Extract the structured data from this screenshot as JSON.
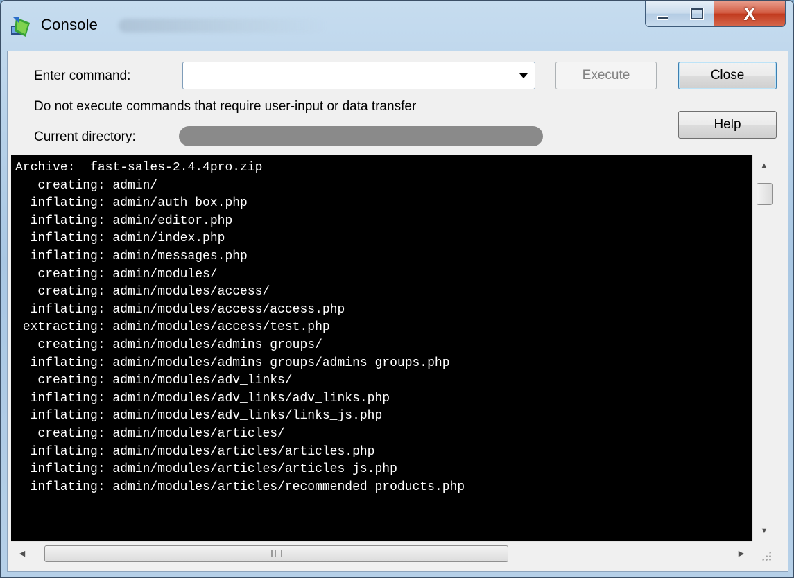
{
  "window": {
    "title": "Console",
    "controls": {
      "minimize": "minimize",
      "maximize": "maximize",
      "close": "X"
    }
  },
  "form": {
    "enter_command_label": "Enter command:",
    "command_value": "",
    "warning_text": "Do not execute commands that require user-input or data transfer",
    "current_directory_label": "Current directory:",
    "execute_label": "Execute",
    "close_label": "Close",
    "help_label": "Help"
  },
  "console": {
    "lines": [
      "Archive:  fast-sales-2.4.4pro.zip",
      "   creating: admin/",
      "  inflating: admin/auth_box.php",
      "  inflating: admin/editor.php",
      "  inflating: admin/index.php",
      "  inflating: admin/messages.php",
      "   creating: admin/modules/",
      "   creating: admin/modules/access/",
      "  inflating: admin/modules/access/access.php",
      " extracting: admin/modules/access/test.php",
      "   creating: admin/modules/admins_groups/",
      "  inflating: admin/modules/admins_groups/admins_groups.php",
      "   creating: admin/modules/adv_links/",
      "  inflating: admin/modules/adv_links/adv_links.php",
      "  inflating: admin/modules/adv_links/links_js.php",
      "   creating: admin/modules/articles/",
      "  inflating: admin/modules/articles/articles.php",
      "  inflating: admin/modules/articles/articles_js.php",
      "  inflating: admin/modules/articles/recommended_products.php"
    ]
  },
  "colors": {
    "console_bg": "#000000",
    "console_fg": "#ffffff",
    "close_button_red": "#c13a1e"
  },
  "icons": {
    "app": "console-app-icon",
    "combo": "chevron-down-icon",
    "scroll_up": "arrow-up-icon",
    "scroll_down": "arrow-down-icon",
    "scroll_left": "arrow-left-icon",
    "scroll_right": "arrow-right-icon",
    "grip": "resize-grip-icon"
  }
}
